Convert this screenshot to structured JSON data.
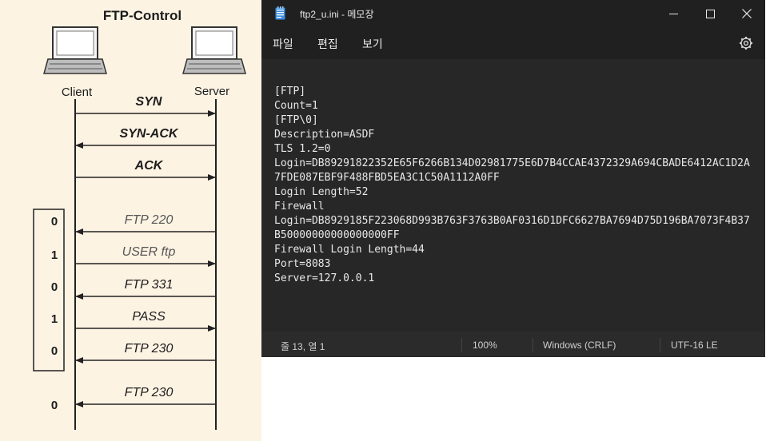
{
  "diagram": {
    "title": "FTP-Control",
    "client_label": "Client",
    "server_label": "Server",
    "messages": [
      {
        "label": "SYN",
        "direction": "right",
        "bit": ""
      },
      {
        "label": "SYN-ACK",
        "direction": "left",
        "bit": ""
      },
      {
        "label": "ACK",
        "direction": "right",
        "bit": ""
      },
      {
        "label": "FTP 220",
        "direction": "left",
        "bit": "0"
      },
      {
        "label": "USER ftp",
        "direction": "right",
        "bit": "1"
      },
      {
        "label": "FTP 331",
        "direction": "left",
        "bit": "0"
      },
      {
        "label": "PASS",
        "direction": "right",
        "bit": "1"
      },
      {
        "label": "FTP 230",
        "direction": "left",
        "bit": "0"
      },
      {
        "label": "FTP 230",
        "direction": "left",
        "bit": "0"
      }
    ]
  },
  "notepad": {
    "title": "ftp2_u.ini - 메모장",
    "icons": {
      "app": "notepad-icon",
      "minimize": "minimize-icon",
      "maximize": "maximize-icon",
      "close": "close-icon",
      "settings": "gear-icon"
    },
    "menu": {
      "file": "파일",
      "edit": "편집",
      "view": "보기"
    },
    "lines": [
      "[FTP]",
      "Count=1",
      "[FTP\\0]",
      "Description=ASDF",
      "TLS 1.2=0",
      "Login=DB89291822352E65F6266B134D02981775E6D7B4CCAE4372329A694CBADE6412AC1D2A",
      "7FDE087EBF9F488FBD5EA3C1C50A1112A0FF",
      "Login Length=52",
      "Firewall",
      "Login=DB8929185F223068D993B763F3763B0AF0316D1DFC6627BA7694D75D196BA7073F4B37",
      "B50000000000000000FF",
      "Firewall Login Length=44",
      "Port=8083",
      "Server=127.0.0.1"
    ],
    "status": {
      "position": "줄 13, 열 1",
      "zoom": "100%",
      "line_ending": "Windows (CRLF)",
      "encoding": "UTF-16 LE"
    }
  }
}
